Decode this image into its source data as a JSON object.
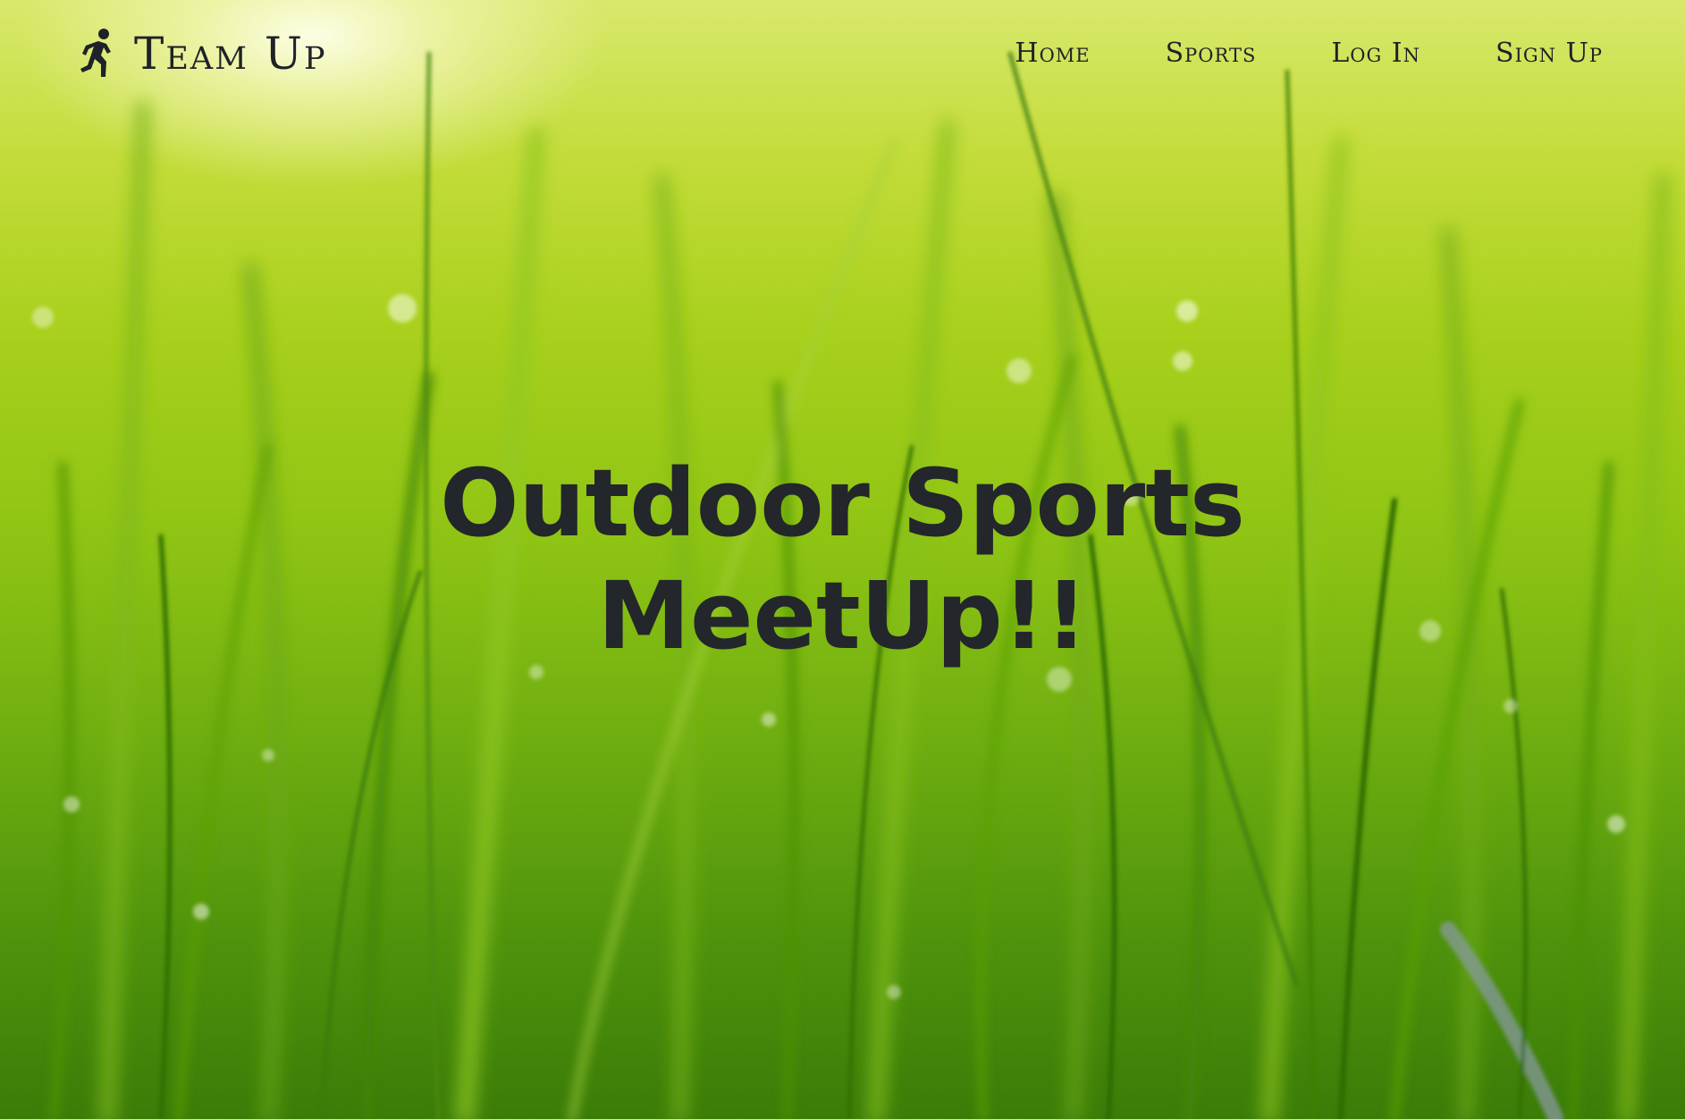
{
  "navbar": {
    "brand": {
      "icon": "running-person-icon",
      "title": "Team Up"
    },
    "links": [
      {
        "label": "Home"
      },
      {
        "label": "Sports"
      },
      {
        "label": "Log In"
      },
      {
        "label": "Sign Up"
      }
    ]
  },
  "hero": {
    "background": "green-grass-photo",
    "headline_line1": "Outdoor Sports",
    "headline_line2": "MeetUp!!",
    "text_color": "#23262b",
    "accent_colors": [
      "#d9e86c",
      "#8fc414",
      "#3b7c08"
    ]
  }
}
